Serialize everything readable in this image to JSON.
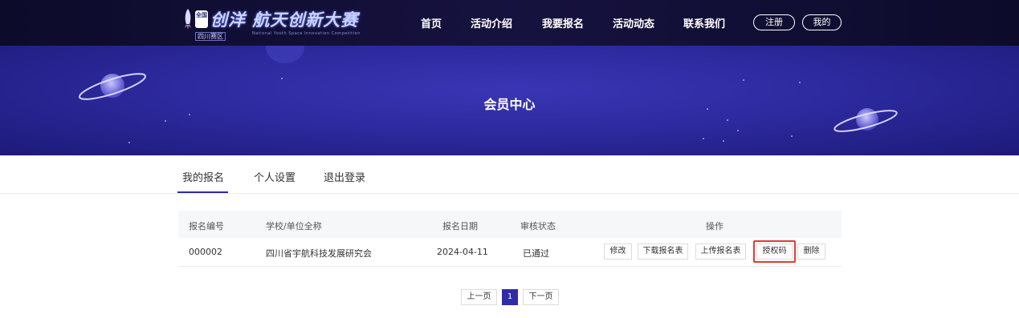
{
  "header": {
    "logo": {
      "badge_text": "全国",
      "title": "创洋 航天创新大赛",
      "subtitle_en": "National Youth Space Innovation Competition",
      "region": "四川赛区"
    },
    "nav": [
      "首页",
      "活动介绍",
      "我要报名",
      "活动动态",
      "联系我们"
    ],
    "register_label": "注册",
    "mine_label": "我的"
  },
  "banner": {
    "title": "会员中心"
  },
  "tabs": [
    "我的报名",
    "个人设置",
    "退出登录"
  ],
  "active_tab": "我的报名",
  "table": {
    "headers": [
      "报名编号",
      "学校/单位全称",
      "报名日期",
      "审核状态",
      "操作"
    ],
    "rows": [
      {
        "id": "000002",
        "school": "四川省宇航科技发展研究会",
        "date": "2024-04-11",
        "status": "已通过",
        "actions": [
          "修改",
          "下载报名表",
          "上传报名表",
          "授权码",
          "删除"
        ]
      }
    ],
    "highlighted_action": "授权码"
  },
  "pagination": {
    "prev": "上一页",
    "current": "1",
    "next": "下一页"
  },
  "colors": {
    "nav_bg": "#0c0b2a",
    "banner": "#2d2a9f",
    "accent": "#2f2ca6",
    "highlight": "#e53935"
  }
}
